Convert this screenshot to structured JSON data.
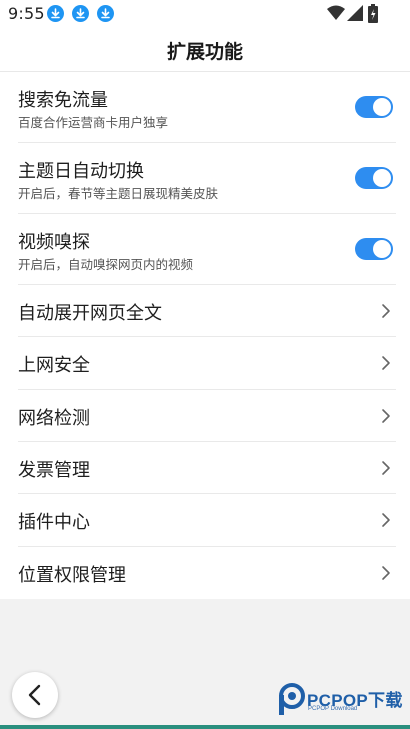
{
  "status_bar": {
    "time": "9:55",
    "icons": [
      "download-icon",
      "download-icon",
      "download-icon",
      "wifi-icon",
      "signal-icon",
      "battery-icon"
    ]
  },
  "header": {
    "title": "扩展功能"
  },
  "settings": {
    "toggles": [
      {
        "title": "搜索免流量",
        "subtitle": "百度合作运营商卡用户独享",
        "on": true
      },
      {
        "title": "主题日自动切换",
        "subtitle": "开启后，春节等主题日展现精美皮肤",
        "on": true
      },
      {
        "title": "视频嗅探",
        "subtitle": "开启后，自动嗅探网页内的视频",
        "on": true
      }
    ],
    "links": [
      {
        "title": "自动展开网页全文"
      },
      {
        "title": "上网安全"
      },
      {
        "title": "网络检测"
      },
      {
        "title": "发票管理"
      },
      {
        "title": "插件中心"
      },
      {
        "title": "位置权限管理"
      }
    ]
  },
  "watermark": {
    "brand": "PCPOP下载",
    "sub": "PCPOP Download"
  },
  "colors": {
    "accent": "#2e8df0",
    "download_badge": "#1e95f3",
    "watermark": "#1f5fa8"
  }
}
